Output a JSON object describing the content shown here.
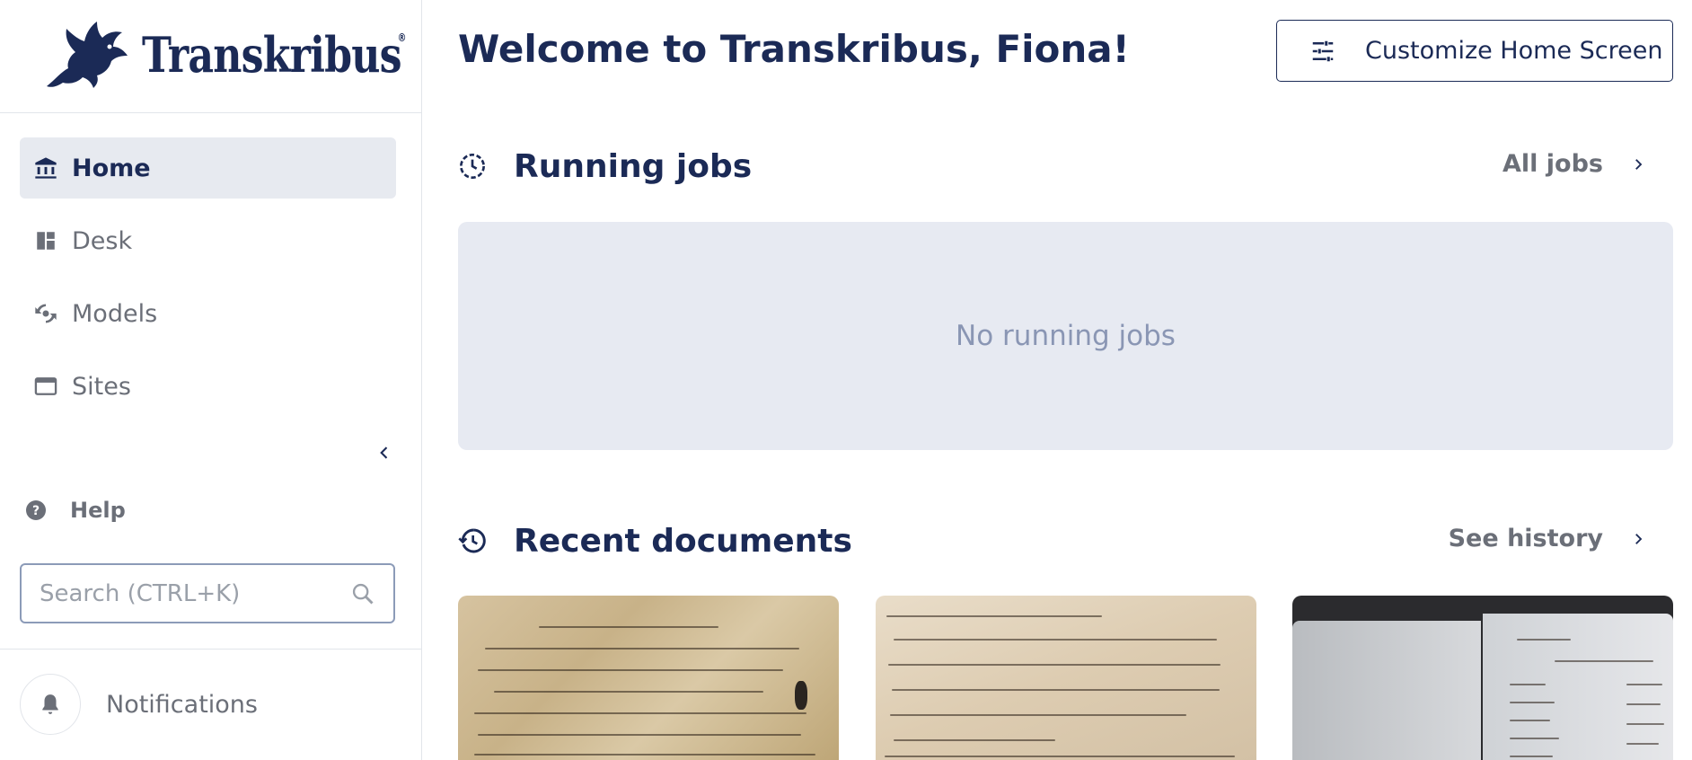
{
  "sidebar": {
    "logo_text": "Transkribus",
    "logo_mark": "®",
    "nav": [
      {
        "label": "Home",
        "icon": "bank-icon",
        "active": true
      },
      {
        "label": "Desk",
        "icon": "dashboard-icon",
        "active": false
      },
      {
        "label": "Models",
        "icon": "model-sync-icon",
        "active": false
      },
      {
        "label": "Sites",
        "icon": "window-icon",
        "active": false
      }
    ],
    "help_label": "Help",
    "search": {
      "placeholder": "Search (CTRL+K)",
      "value": ""
    },
    "notifications_label": "Notifications"
  },
  "main": {
    "welcome": "Welcome to Transkribus, Fiona!",
    "customize_label": "Customize Home Screen",
    "running_jobs": {
      "title": "Running jobs",
      "link_label": "All jobs",
      "empty_text": "No running jobs"
    },
    "recent_documents": {
      "title": "Recent documents",
      "link_label": "See history"
    }
  },
  "colors": {
    "navy": "#1b2a56",
    "muted": "#6b6f78",
    "active_bg": "#e7eaf0",
    "empty_text": "#8a96b4",
    "search_border": "#8c9bb8"
  }
}
